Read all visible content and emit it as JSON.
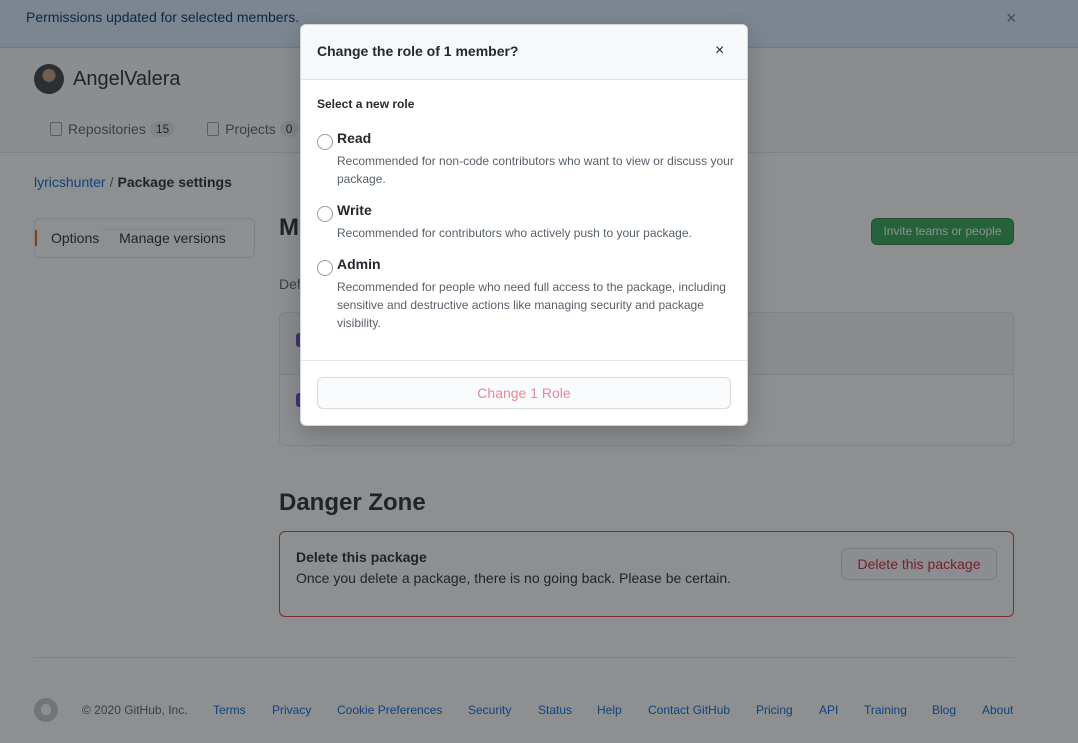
{
  "flash": {
    "message": "Permissions updated for selected members.",
    "close": "×"
  },
  "org": {
    "name": "AngelValera",
    "tabs": [
      {
        "label": "Repositories",
        "count": "15"
      },
      {
        "label": "Projects",
        "count": "0"
      }
    ]
  },
  "breadcrumb": {
    "owner": "lyricshunter",
    "separator": "/",
    "current": "Package settings"
  },
  "sidebar": {
    "items": [
      {
        "label": "Options"
      },
      {
        "label": "Manage versions"
      }
    ]
  },
  "main": {
    "heading_fragment": "M",
    "description_fragment": "Def",
    "invite_label": "Invite teams or people"
  },
  "danger": {
    "heading": "Danger Zone",
    "title": "Delete this package",
    "description": "Once you delete a package, there is no going back. Please be certain.",
    "button": "Delete this package"
  },
  "footer": {
    "copyright": "© 2020 GitHub, Inc.",
    "links": [
      "Terms",
      "Privacy",
      "Cookie Preferences",
      "Security",
      "Status",
      "Help",
      "Contact GitHub",
      "Pricing",
      "API",
      "Training",
      "Blog",
      "About"
    ]
  },
  "dialog": {
    "title": "Change the role of 1 member?",
    "close": "×",
    "select_label": "Select a new role",
    "roles": [
      {
        "name": "Read",
        "description": "Recommended for non-code contributors who want to view or discuss your package."
      },
      {
        "name": "Write",
        "description": "Recommended for contributors who actively push to your package."
      },
      {
        "name": "Admin",
        "description": "Recommended for people who need full access to the package, including sensitive and destructive actions like managing security and package visibility."
      }
    ],
    "submit_label": "Change 1 Role"
  },
  "colors": {
    "accent_link": "#0366d6",
    "primary_button": "#2ea44f",
    "danger": "#d73a49",
    "flash_bg": "#dbedff"
  }
}
